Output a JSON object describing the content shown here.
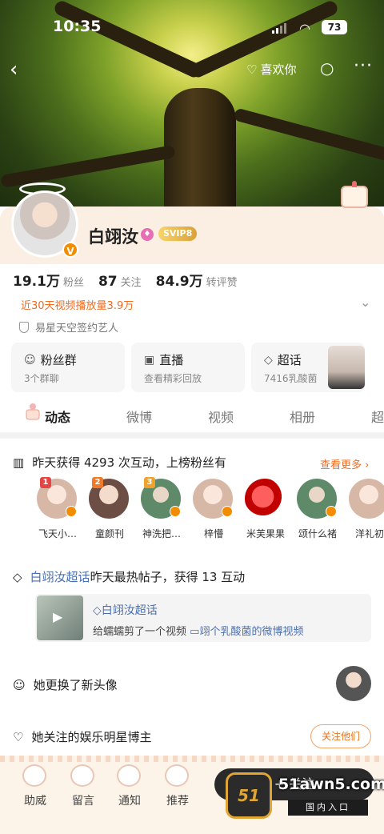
{
  "status_bar": {
    "time": "10:35",
    "battery": "73"
  },
  "nav": {
    "like_label": "喜欢你"
  },
  "profile": {
    "name": "白翊汝",
    "svip": "SVIP8",
    "vbadge": "V",
    "stats": [
      {
        "value": "19.1万",
        "label": "粉丝"
      },
      {
        "value": "87",
        "label": "关注"
      },
      {
        "value": "84.9万",
        "label": "转评赞"
      }
    ],
    "play_count": "近30天视频播放量3.9万",
    "signed": "易星天空签约艺人"
  },
  "cards": [
    {
      "title": "粉丝群",
      "sub": "3个群聊",
      "icon": "fans-group-icon"
    },
    {
      "title": "直播",
      "sub": "查看精彩回放",
      "icon": "live-icon"
    },
    {
      "title": "超话",
      "sub": "7416乳酸菌",
      "icon": "diamond-icon"
    }
  ],
  "tabs": [
    "动态",
    "微博",
    "视频",
    "相册",
    "超"
  ],
  "feed": {
    "interaction_title": "昨天获得 4293 次互动，上榜粉丝有",
    "more": "查看更多 ›",
    "fans": [
      {
        "name": "飞天小…",
        "rank": "1",
        "rank_color": "#e64545"
      },
      {
        "name": "童颜刊",
        "rank": "2",
        "rank_color": "#f07a2a"
      },
      {
        "name": "神洗把…",
        "rank": "3",
        "rank_color": "#f0a22a"
      },
      {
        "name": "梓懵",
        "rank": "",
        "rank_color": ""
      },
      {
        "name": "米芙果果",
        "rank": "",
        "rank_color": ""
      },
      {
        "name": "颂什么褚",
        "rank": "",
        "rank_color": ""
      },
      {
        "name": "洋礼初",
        "rank": "",
        "rank_color": ""
      }
    ],
    "hot_title_link": "白翊汝超话",
    "hot_title_rest": "昨天最热帖子，获得 13 互动",
    "hot_card_topic": "◇白翊汝超话",
    "hot_card_text": "给蠕蠕剪了一个视频",
    "hot_card_link": "▭翊个乳酸菌的微博视频",
    "avatar_change": "她更换了新头像",
    "follow_stars": "她关注的娱乐明星博主",
    "follow_them": "关注他们"
  },
  "bottom_bar": {
    "items": [
      "助威",
      "留言",
      "通知",
      "推荐"
    ],
    "follow": "+ 关注"
  },
  "watermark": {
    "site": "51awn5.com",
    "entry": "国内入口",
    "badge": "51"
  },
  "colors": {
    "orange": "#f26b1d",
    "link_blue": "#4a6fb1"
  }
}
